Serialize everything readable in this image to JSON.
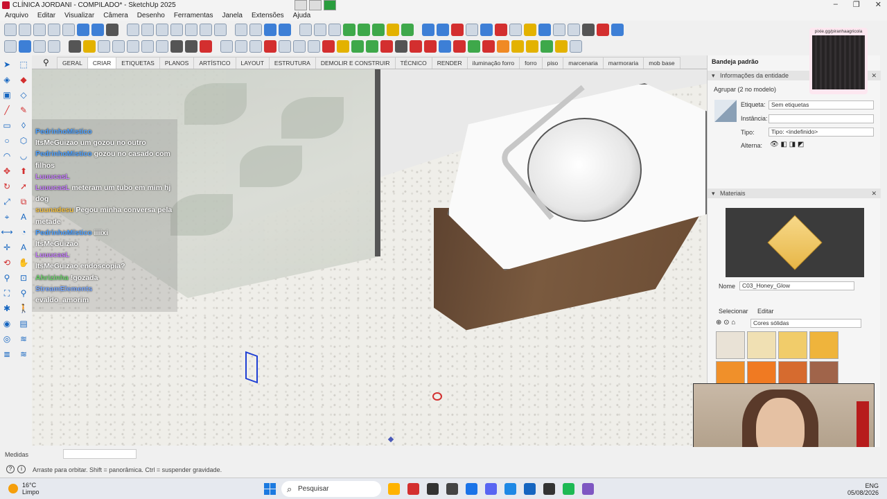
{
  "window": {
    "title": "CLÍNICA JORDANI - COMPILADO* - SketchUp 2025"
  },
  "menu": [
    "Arquivo",
    "Editar",
    "Visualizar",
    "Câmera",
    "Desenho",
    "Ferramentas",
    "Janela",
    "Extensões",
    "Ajuda"
  ],
  "tabs": [
    "GERAL",
    "CRIAR",
    "ETIQUETAS",
    "PLANOS",
    "ARTÍSTICO",
    "LAYOUT",
    "ESTRUTURA",
    "DEMOLIR E CONSTRUIR",
    "TÉCNICO",
    "RENDER",
    "iluminação forro",
    "forro",
    "piso",
    "marcenaria",
    "marmoraria",
    "mob base"
  ],
  "active_tab": "CRIAR",
  "chat": [
    {
      "user": "PedrinhoMistico",
      "text": "",
      "color": "#4ea1ff"
    },
    {
      "user": "ItsMeGuizao",
      "text": "um gozou no outro",
      "color": "#ffffff"
    },
    {
      "user": "PedrinhoMistico",
      "text": "gozou no casado com filhos",
      "color": "#4ea1ff"
    },
    {
      "user": "LuuucasL",
      "text": "",
      "color": "#c77dff"
    },
    {
      "user": "LuuucasL",
      "text": "meteram um tubo em mim hj dog",
      "color": "#c77dff"
    },
    {
      "user": "suunadesu",
      "text": "Pegou minha conversa pela metade",
      "color": "#f5c242"
    },
    {
      "user": "PedrinhoMistico",
      "text": "iiiixi",
      "color": "#4ea1ff"
    },
    {
      "user": "ItsMeGuizao",
      "text": "",
      "color": "#ffffff"
    },
    {
      "user": "LuuucasL",
      "text": "",
      "color": "#c77dff"
    },
    {
      "user": "ItsMeGuizao",
      "text": "endoscopia?",
      "color": "#ffffff"
    },
    {
      "user": "Ahrizinha",
      "text": "!gozada",
      "color": "#6bd46b"
    },
    {
      "user": "StreamElements",
      "text": "",
      "color": "#7aa9ff"
    },
    {
      "user": "",
      "text": "evaldo_amorim",
      "color": "#ffffff"
    }
  ],
  "tray": {
    "title": "Bandeja padrão",
    "entity_section": "Informações da entidade",
    "entity_name": "Agrupar (2 no modelo)",
    "label_tag": "Etiqueta:",
    "tag_value": "Sem etiquetas",
    "label_instance": "Instância:",
    "instance_value": "",
    "label_type": "Tipo:",
    "type_value": "Tipo: <indefinido>",
    "label_toggle": "Alterna:",
    "materials_section": "Materiais",
    "name_label": "Nome",
    "material_name": "C03_Honey_Glow",
    "select_tab": "Selecionar",
    "edit_tab": "Editar",
    "library": "Cores sólidas",
    "swatches": [
      "#e9e2d6",
      "#f0e0b3",
      "#f1cc6a",
      "#efb43c",
      "#f0902a",
      "#f07a22",
      "#d66b2f",
      "#a0644a"
    ]
  },
  "qr": {
    "text": "pixie.gg/piranhaagricola"
  },
  "status": {
    "measures_label": "Medidas",
    "hint": "Arraste para orbitar. Shift = panorâmica. Ctrl = suspender gravidade."
  },
  "taskbar": {
    "temperature": "16°C",
    "condition": "Limpo",
    "search_placeholder": "Pesquisar",
    "lang": "ENG",
    "date": "05/08/2026",
    "app_colors": [
      "#ffb300",
      "#d32f2f",
      "#333333",
      "#444444",
      "#1a73e8",
      "#5865f2",
      "#1e88e5",
      "#1565c0",
      "#333333",
      "#1db954",
      "#7e57c2"
    ]
  }
}
